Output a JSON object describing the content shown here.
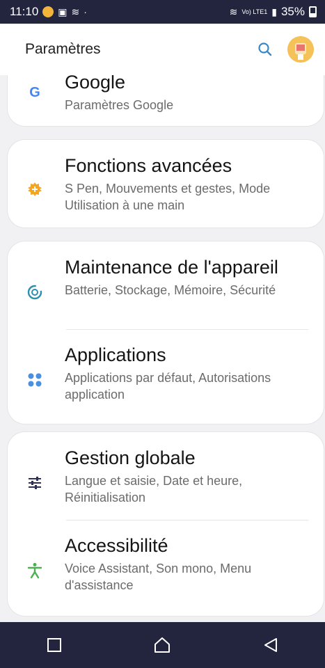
{
  "status_bar": {
    "time": "11:10",
    "battery": "35%",
    "network": "Vo) LTE1"
  },
  "header": {
    "title": "Paramètres",
    "search_icon": "search-icon",
    "avatar_icon": "avatar"
  },
  "items": [
    {
      "title": "Google",
      "subtitle": "Paramètres Google",
      "icon": "google-icon",
      "color": "#4285f4"
    },
    {
      "title": "Fonctions avancées",
      "subtitle": "S Pen, Mouvements et gestes, Mode Utilisation à une main",
      "icon": "gear-plus-icon",
      "color": "#f4a623"
    },
    {
      "title": "Maintenance de l'appareil",
      "subtitle": "Batterie, Stockage, Mémoire, Sécurité",
      "icon": "device-care-icon",
      "color": "#2d8fb0"
    },
    {
      "title": "Applications",
      "subtitle": "Applications par défaut, Autorisations application",
      "icon": "apps-grid-icon",
      "color": "#4a90e2"
    },
    {
      "title": "Gestion globale",
      "subtitle": "Langue et saisie, Date et heure, Réinitialisation",
      "icon": "sliders-icon",
      "color": "#2b2f5a"
    },
    {
      "title": "Accessibilité",
      "subtitle": "Voice Assistant, Son mono, Menu d'assistance",
      "icon": "accessibility-icon",
      "color": "#4caf50"
    }
  ],
  "nav": {
    "recent": "recent-apps-icon",
    "home": "home-icon",
    "back": "back-icon"
  }
}
